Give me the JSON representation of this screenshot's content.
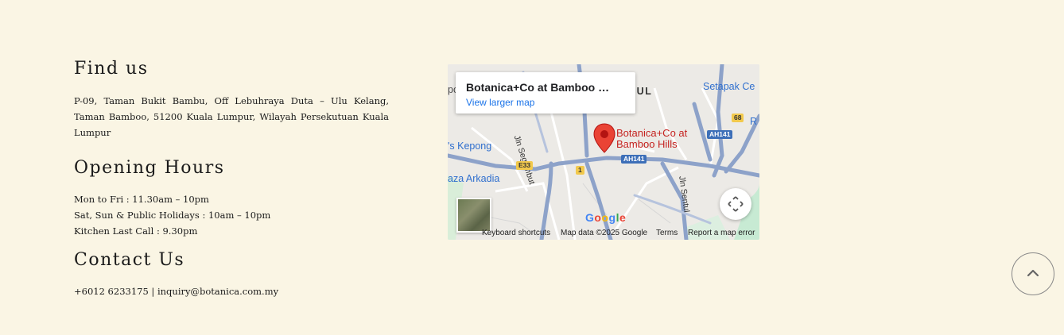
{
  "find_us": {
    "heading": "Find us",
    "address": "P-09, Taman Bukit Bambu, Off Lebuhraya Duta – Ulu Kelang, Taman Bamboo, 51200 Kuala Lumpur, Wilayah Persekutuan Kuala Lumpur"
  },
  "opening_hours": {
    "heading": "Opening Hours",
    "lines": [
      "Mon to Fri : 11.30am – 10pm",
      "Sat, Sun & Public Holidays : 10am – 10pm",
      "Kitchen Last Call : 9.30pm"
    ]
  },
  "contact": {
    "heading": "Contact Us",
    "line": "+6012 6233175 | inquiry@botanica.com.my"
  },
  "map": {
    "card_title": "Botanica+Co at Bamboo …",
    "card_link": "View larger map",
    "pin_label_1": "Botanica+Co at",
    "pin_label_2": "Bamboo Hills",
    "labels": {
      "sentul": "NTUL",
      "setapak": "Setapak Ce",
      "kepong": "'s Kepong",
      "arkadia": "aza Arkadia",
      "segambut": "Jln Segambut",
      "jln_sentul": "Jln Sentul",
      "edge_left": "pc",
      "edge_right": "R"
    },
    "shields": {
      "ah141_a": "AH141",
      "ah141_b": "AH141",
      "r68": "68",
      "e33": "E33",
      "r1": "1"
    },
    "google_logo": "Google",
    "attribution": {
      "keyboard": "Keyboard shortcuts",
      "mapdata": "Map data ©2025 Google",
      "terms": "Terms",
      "report": "Report a map error"
    },
    "colors": {
      "pin": "#ea4335",
      "road_major": "#8da2c9",
      "park": "#c7ead3"
    }
  }
}
